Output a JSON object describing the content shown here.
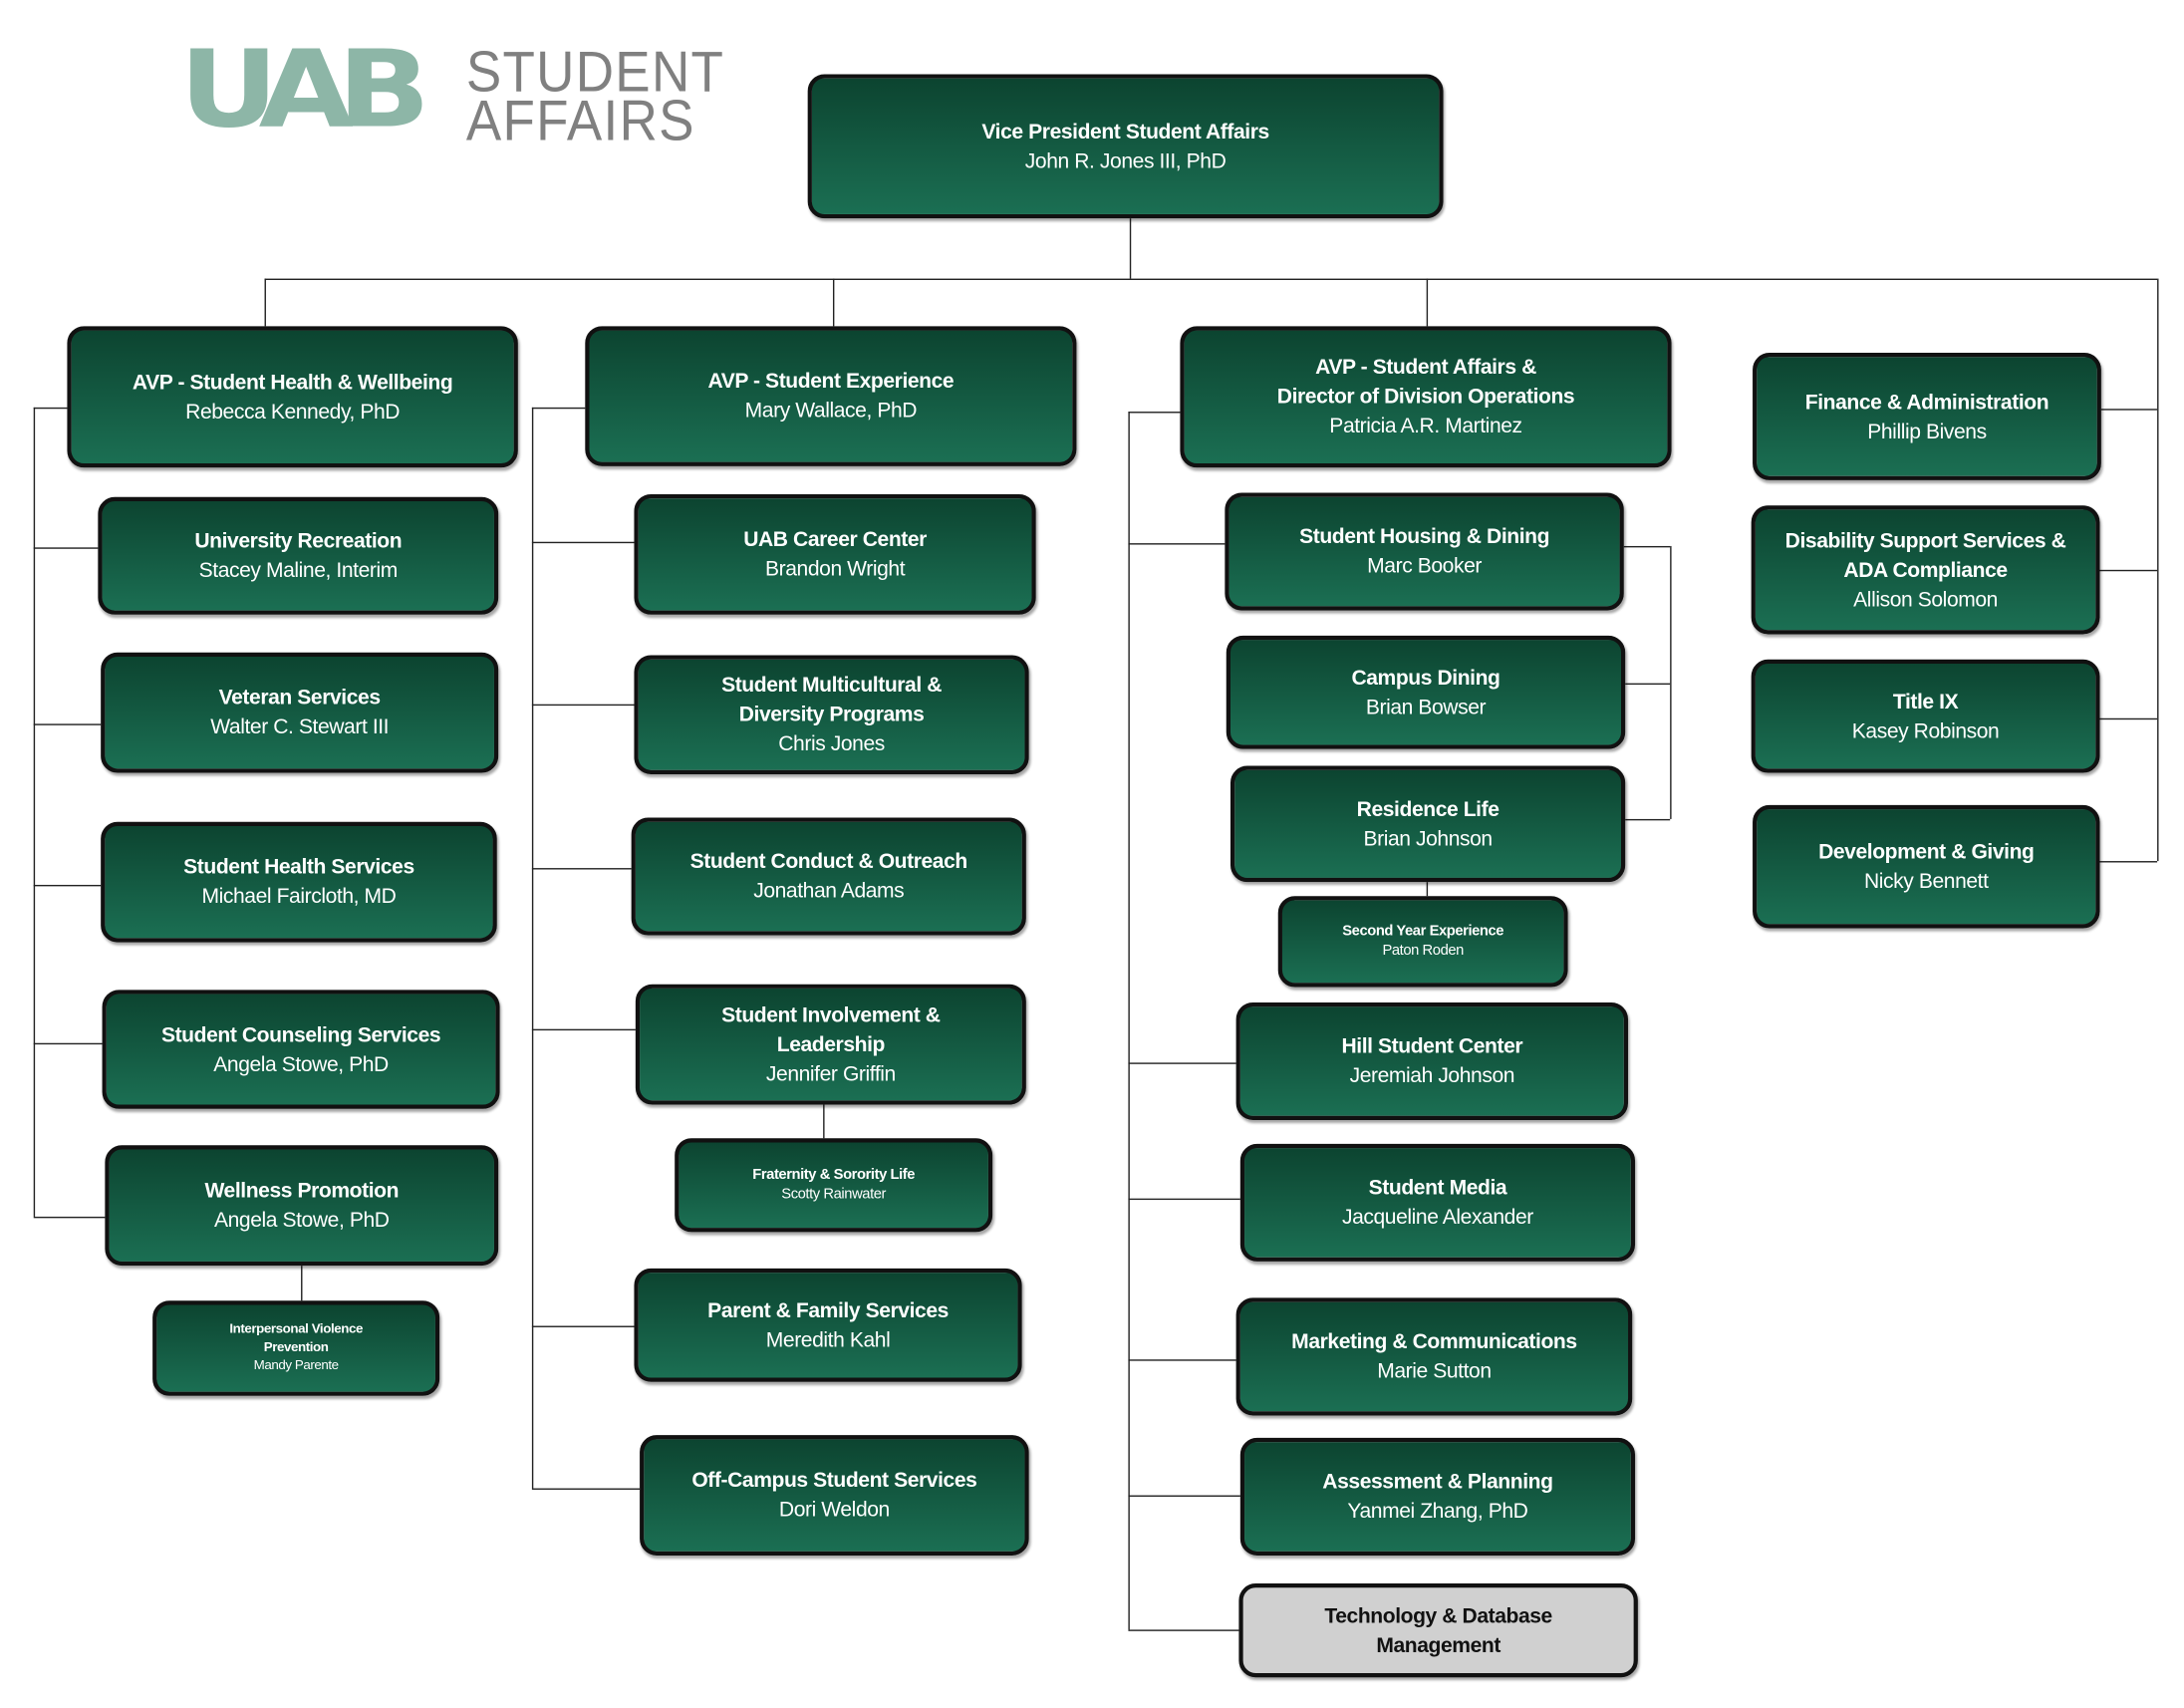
{
  "logo": {
    "mark": "UAB",
    "line1": "STUDENT",
    "line2": "AFFAIRS",
    "color": "#8db6a7"
  },
  "colors": {
    "box_top": "#0c4430",
    "box_bottom": "#1b6f53",
    "box_gray": "#d0d0d0"
  },
  "vp": {
    "title": "Vice President Student Affairs",
    "name": "John R. Jones III, PhD"
  },
  "avp_health": {
    "title": "AVP - Student Health & Wellbeing",
    "name": "Rebecca Kennedy, PhD"
  },
  "avp_experience": {
    "title": "AVP - Student Experience",
    "name": "Mary Wallace, PhD"
  },
  "avp_operations": {
    "title": "AVP - Student Affairs &\nDirector of Division Operations",
    "name": "Patricia A.R. Martinez"
  },
  "health_units": [
    {
      "title": "University Recreation",
      "name": "Stacey Maline, Interim"
    },
    {
      "title": "Veteran Services",
      "name": "Walter C. Stewart III"
    },
    {
      "title": "Student Health Services",
      "name": "Michael Faircloth, MD"
    },
    {
      "title": "Student Counseling Services",
      "name": "Angela Stowe, PhD"
    },
    {
      "title": "Wellness Promotion",
      "name": "Angela Stowe, PhD"
    },
    {
      "title": "Interpersonal Violence\nPrevention",
      "name": "Mandy Parente"
    }
  ],
  "experience_units": [
    {
      "title": "UAB Career Center",
      "name": "Brandon Wright"
    },
    {
      "title": "Student Multicultural &\nDiversity Programs",
      "name": "Chris Jones"
    },
    {
      "title": "Student Conduct & Outreach",
      "name": "Jonathan Adams"
    },
    {
      "title": "Student Involvement &\nLeadership",
      "name": "Jennifer Griffin"
    },
    {
      "title": "Fraternity & Sorority Life",
      "name": "Scotty Rainwater"
    },
    {
      "title": "Parent & Family Services",
      "name": "Meredith Kahl"
    },
    {
      "title": "Off-Campus Student Services",
      "name": "Dori Weldon"
    }
  ],
  "operations_units": [
    {
      "title": "Student Housing & Dining",
      "name": "Marc Booker"
    },
    {
      "title": "Campus Dining",
      "name": "Brian Bowser"
    },
    {
      "title": "Residence Life",
      "name": "Brian Johnson"
    },
    {
      "title": "Second Year Experience",
      "name": "Paton Roden"
    },
    {
      "title": "Hill Student Center",
      "name": "Jeremiah Johnson"
    },
    {
      "title": "Student Media",
      "name": "Jacqueline Alexander"
    },
    {
      "title": "Marketing & Communications",
      "name": "Marie Sutton"
    },
    {
      "title": "Assessment & Planning",
      "name": "Yanmei Zhang, PhD"
    },
    {
      "title": "Technology & Database\nManagement"
    }
  ],
  "direct_units": [
    {
      "title": "Finance & Administration",
      "name": "Phillip Bivens"
    },
    {
      "title": "Disability Support  Services &\nADA Compliance",
      "name": "Allison Solomon"
    },
    {
      "title": "Title IX",
      "name": "Kasey Robinson"
    },
    {
      "title": "Development & Giving",
      "name": "Nicky Bennett"
    }
  ]
}
